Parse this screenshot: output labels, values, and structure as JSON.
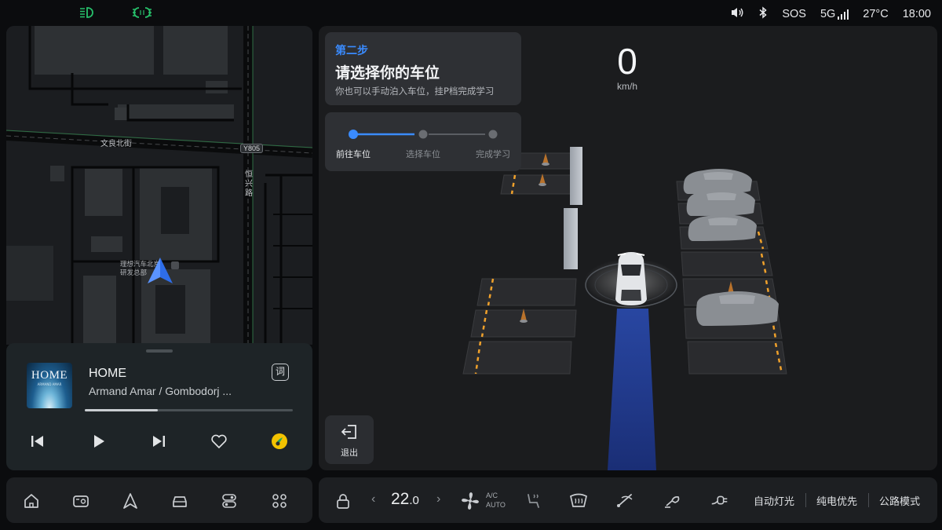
{
  "status_bar": {
    "sos": "SOS",
    "network": "5G",
    "temperature": "27°C",
    "time": "18:00",
    "icons": [
      "headlight-icon",
      "parking-light-icon",
      "volume-icon",
      "bluetooth-icon",
      "signal-icon"
    ]
  },
  "map": {
    "street_1": "文良北街",
    "street_2_lines": [
      "恒",
      "兴",
      "路"
    ],
    "road_badge": "Y805",
    "poi_line1": "理想汽车北京",
    "poi_line2": "研发总部"
  },
  "media": {
    "cover_title": "HOME",
    "cover_subtitle": "ARMAND AMAR",
    "title": "HOME",
    "artist": "Armand Amar / Gombodorj ...",
    "lyrics_label": "词",
    "progress": 0.35
  },
  "parking": {
    "step_number": "第二步",
    "step_title": "请选择你的车位",
    "step_description": "你也可以手动泊入车位，挂P档完成学习",
    "steps": [
      {
        "label": "前往车位",
        "active": true
      },
      {
        "label": "选择车位",
        "active": false
      },
      {
        "label": "完成学习",
        "active": false
      }
    ],
    "speed_value": "0",
    "speed_unit": "km/h",
    "exit_label": "退出"
  },
  "climate": {
    "temperature": "22",
    "temperature_decimal": ".0",
    "prev": "‹",
    "next": "›",
    "ac_line1": "A/C",
    "ac_line2": "AUTO"
  },
  "modes": {
    "auto_lights": "自动灯光",
    "ev_priority": "纯电优先",
    "road_mode": "公路模式"
  },
  "colors": {
    "accent": "#3a8bff",
    "panel": "#1b1c1e",
    "parking_line": "#f0a12b",
    "path": "#1f3c8f"
  }
}
